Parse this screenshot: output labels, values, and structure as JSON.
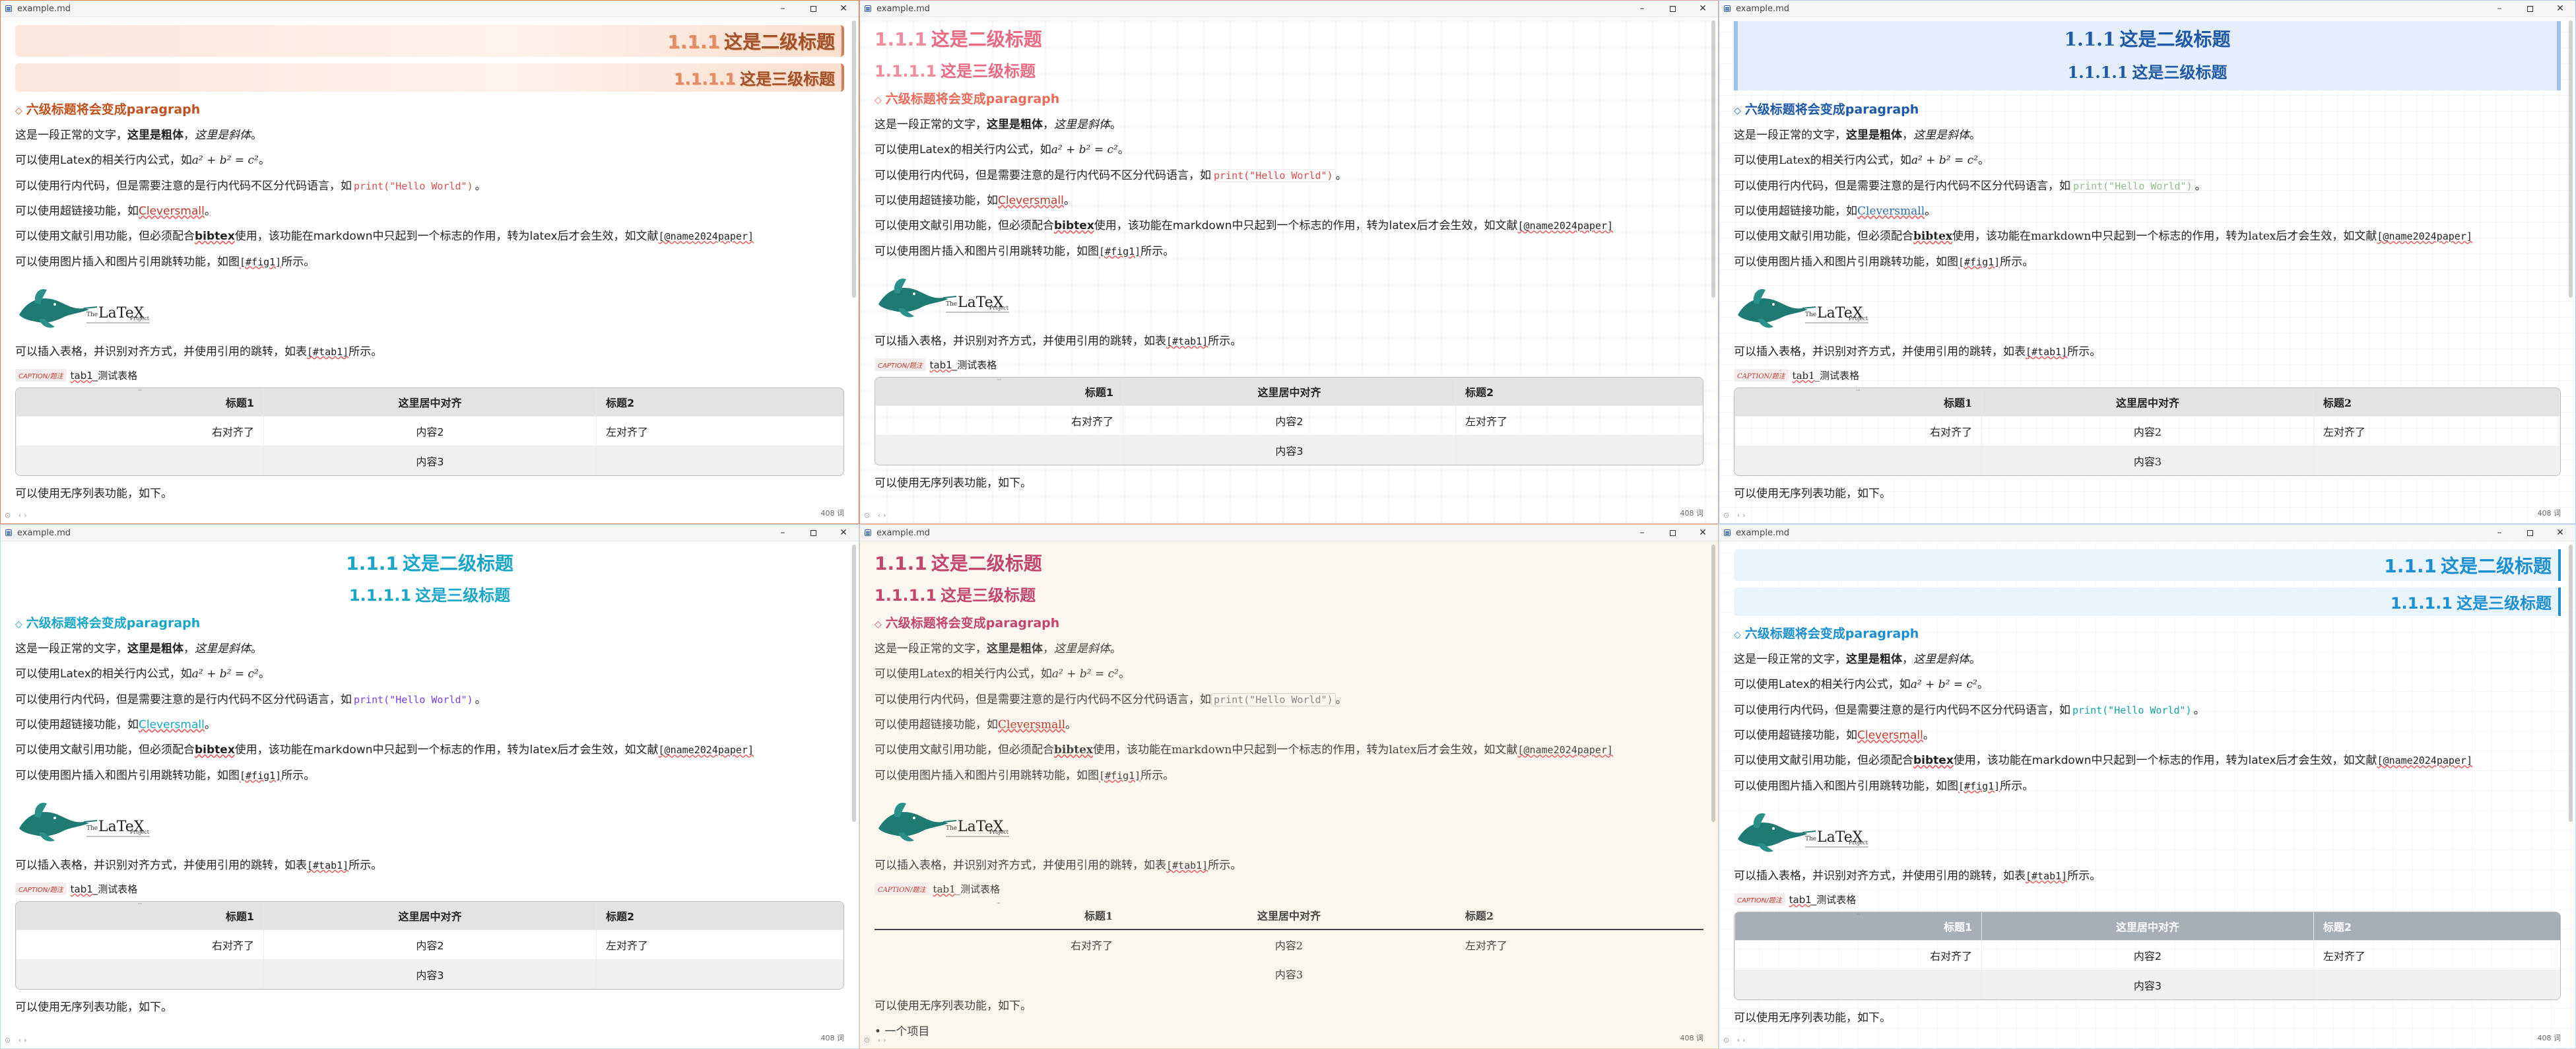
{
  "doc": {
    "filename": "example.md",
    "h2": "这是二级标题",
    "h2_num": "1.1.1",
    "h3": "这是三级标题",
    "h3_num": "1.1.1.1",
    "h6": "六级标题将会变成paragraph",
    "p1_a": "这是一段正常的文字，",
    "p1_b": "这里是粗体",
    "p1_c": "，",
    "p1_d": "这里是斜体",
    "p1_e": "。",
    "p2_a": "可以使用Latex的相关行内公式，如",
    "p2_math": "a² + b² = c²",
    "p2_e": "。",
    "p3_a": "可以使用行内代码，但是需要注意的是行内代码不区分代码语言，如",
    "p3_code": "print(\"Hello World\")",
    "p3_e": "。",
    "p4_a": "可以使用超链接功能，如",
    "p4_link": "Cleversmall",
    "p4_e": "。",
    "p5_a": "可以使用文献引用功能，但必须配合",
    "p5_b": "bibtex",
    "p5_c": "使用，该功能在markdown中只起到一个标志的作用，转为latex后才会生效，如文献",
    "p5_cite": "[@name2024paper]",
    "p6_a": "可以使用图片插入和图片引用跳转功能，如图",
    "p6_ref": "[#fig1]",
    "p6_e": "所示。",
    "p7_a": "可以插入表格，并识别对齐方式，并使用引用的跳转，如表",
    "p7_ref": "[#tab1]",
    "p7_e": "所示。",
    "caption_tag": "CAPTION/题注",
    "caption_ref": "tab1",
    "caption_text": "_测试表格",
    "table": {
      "headers": [
        "标题1",
        "这里居中对齐",
        "标题2"
      ],
      "rows": [
        [
          "右对齐了",
          "内容2",
          "左对齐了"
        ],
        [
          "",
          "内容3",
          ""
        ]
      ]
    },
    "list_line": "可以使用无序列表功能，如下。",
    "list_item": "一个项目",
    "wordcount": "408 词",
    "logo_the": "The",
    "logo_latex": "LaTeX",
    "logo_project": "Project"
  },
  "themes": [
    "gradient-brown",
    "neon-pink",
    "typora-blue",
    "white-cyan",
    "paper-peach",
    "sky"
  ],
  "window_controls": {
    "minimize": "–",
    "close": "✕"
  }
}
